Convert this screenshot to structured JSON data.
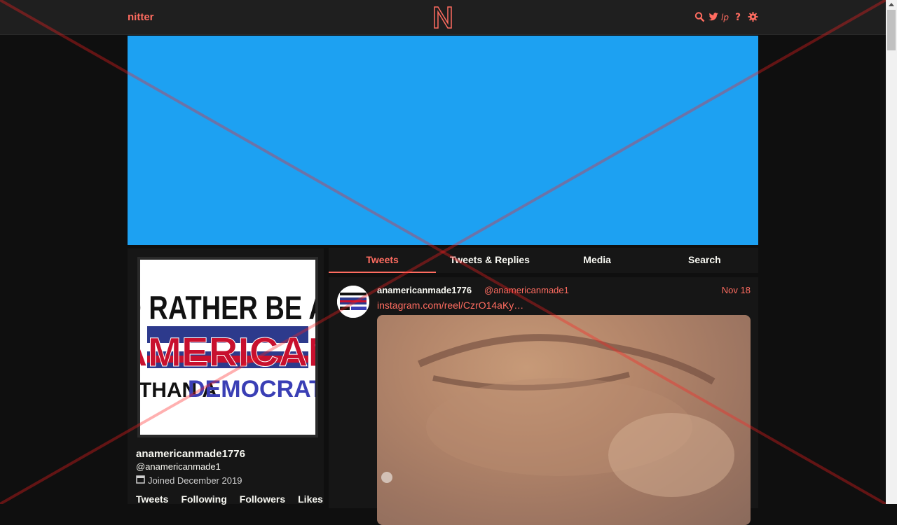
{
  "nav": {
    "site_name": "nitter",
    "logo_letter": "N",
    "icons": [
      "search-icon",
      "twitter-icon",
      "lp-icon",
      "help-icon",
      "settings-icon"
    ]
  },
  "colors": {
    "accent": "#ff6c60",
    "banner": "#1da1f2",
    "background": "#0f0f0f",
    "panel": "#161616"
  },
  "profile": {
    "fullname": "anamericanmade1776",
    "username": "@anamericanmade1",
    "joined": "Joined December 2019",
    "avatar_text": [
      "I'D RATHER BE AN",
      "AMERICAN",
      "THAN A",
      "DEMOCRAT"
    ],
    "stats": [
      "Tweets",
      "Following",
      "Followers",
      "Likes"
    ]
  },
  "tabs": [
    "Tweets",
    "Tweets & Replies",
    "Media",
    "Search"
  ],
  "active_tab": "Tweets",
  "tweet": {
    "fullname": "anamericanmade1776",
    "username": "@anamericanmade1",
    "date": "Nov 18",
    "link": "instagram.com/reel/CzrO14aKy…"
  }
}
